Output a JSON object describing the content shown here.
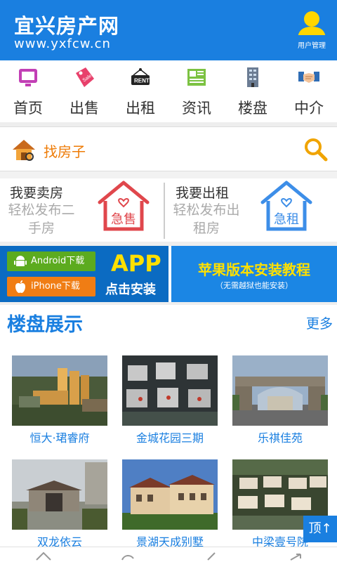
{
  "header": {
    "brand_name": "宜兴房产网",
    "brand_url": "www.yxfcw.cn",
    "user_label": "用户管理",
    "accent_color": "#1a7fe0"
  },
  "nav": {
    "items": [
      {
        "label": "首页",
        "icon": "monitor-icon"
      },
      {
        "label": "出售",
        "icon": "sale-tag-icon"
      },
      {
        "label": "出租",
        "icon": "rent-sign-icon"
      },
      {
        "label": "资讯",
        "icon": "newspaper-icon"
      },
      {
        "label": "楼盘",
        "icon": "building-icon"
      },
      {
        "label": "中介",
        "icon": "handshake-icon"
      }
    ]
  },
  "search": {
    "label": "找房子"
  },
  "post": {
    "sell": {
      "title": "我要卖房",
      "subtitle_line1": "轻松发布二",
      "subtitle_line2": "手房",
      "badge": "急售"
    },
    "rent": {
      "title": "我要出租",
      "subtitle_line1": "轻松发布出",
      "subtitle_line2": "租房",
      "badge": "急租"
    }
  },
  "banner": {
    "android_label": "Android下载",
    "iphone_label": "iPhone下载",
    "app_title": "APP",
    "app_subtitle": "点击安装",
    "tutorial_title": "苹果版本安装教程",
    "tutorial_subtitle": "（无需越狱也能安装）"
  },
  "listings": {
    "title": "楼盘展示",
    "more_label": "更多",
    "items": [
      {
        "name": "恒大·珺睿府"
      },
      {
        "name": "金城花园三期"
      },
      {
        "name": "乐祺佳苑"
      },
      {
        "name": "双龙依云"
      },
      {
        "name": "景湖天成别墅"
      },
      {
        "name": "中梁壹号院"
      }
    ]
  },
  "top_button": "顶↑"
}
